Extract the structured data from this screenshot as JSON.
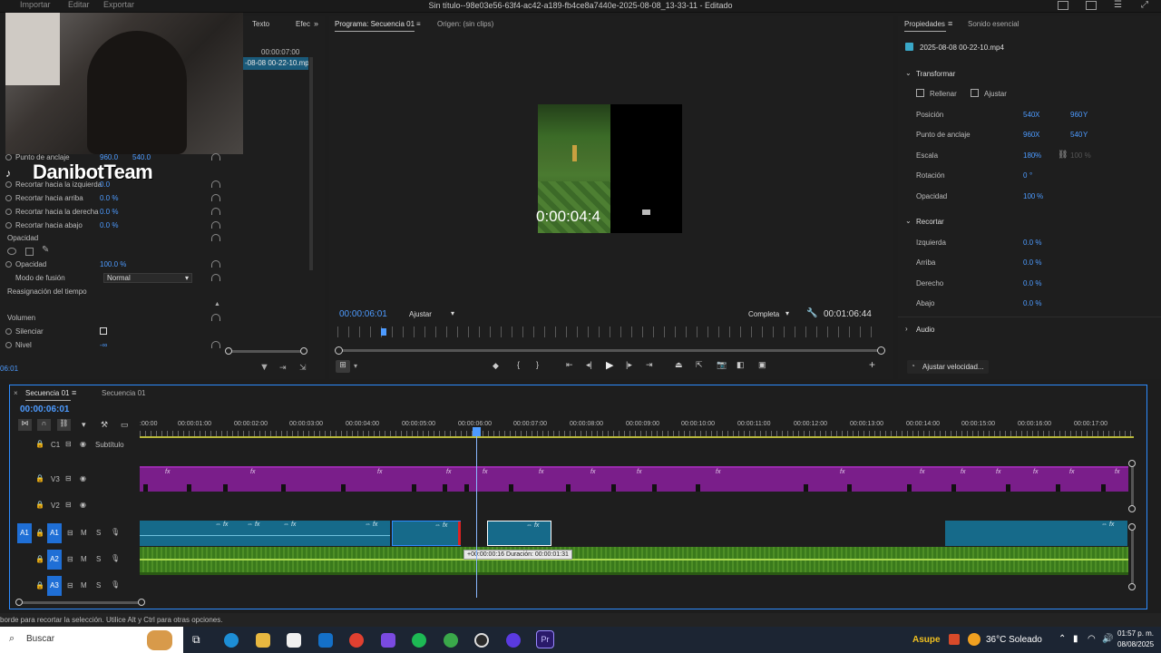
{
  "app": {
    "title": "Sin título--98e03e56-63f4-ac42-a189-fb4ce8a7440e-2025-08-08_13-33-11 - Editado",
    "menu": [
      "Importar",
      "Editar",
      "Exportar"
    ]
  },
  "overlay": {
    "watermark": "DanibotTeam"
  },
  "project_panel": {
    "tabs": [
      "Texto",
      "Efec"
    ],
    "timecode": "00:00:07:00",
    "clip": "-08-08 00-22-10.mp4"
  },
  "effect_controls": {
    "rows": [
      {
        "label": "Punto de anclaje",
        "val1": "960.0",
        "val2": "540.0"
      },
      {
        "label": "Recortar hacia la izquierda",
        "val1": "0.0"
      },
      {
        "label": "Recortar hacia arriba",
        "val1": "0.0 %"
      },
      {
        "label": "Recortar hacia la derecha",
        "val1": "0.0 %"
      },
      {
        "label": "Recortar hacia abajo",
        "val1": "0.0 %"
      },
      {
        "label": "Opacidad",
        "val1": ""
      },
      {
        "label": "Opacidad",
        "val1": "100.0 %"
      },
      {
        "label": "Modo de fusión",
        "val1": "Normal"
      },
      {
        "label": "Reasignación del tiempo",
        "val1": ""
      },
      {
        "label": "Volumen",
        "val1": ""
      },
      {
        "label": "Silenciar",
        "val1": ""
      },
      {
        "label": "Nivel",
        "val1": "-∞"
      }
    ],
    "timecode": "06:01"
  },
  "program": {
    "tab_program": "Programa: Secuencia 01",
    "tab_source": "Origen: (sin clips)",
    "overlay_timecode": "0:00:04:4",
    "timecode": "00:00:06:01",
    "fit": "Ajustar",
    "quality": "Completa",
    "duration": "00:01:06:44"
  },
  "properties": {
    "tab_props": "Propiedades",
    "tab_sound": "Sonido esencial",
    "file": "2025-08-08 00-22-10.mp4",
    "transform": "Transformar",
    "fill": "Rellenar",
    "fit": "Ajustar",
    "rows": [
      {
        "label": "Posición",
        "a": "540",
        "au": "X",
        "b": "960",
        "bu": "Y"
      },
      {
        "label": "Punto de anclaje",
        "a": "960",
        "au": "X",
        "b": "540",
        "bu": "Y"
      },
      {
        "label": "Escala",
        "a": "180",
        "au": "%",
        "b": "100 %",
        "bu": ""
      },
      {
        "label": "Rotación",
        "a": "0",
        "au": "°",
        "b": "",
        "bu": ""
      },
      {
        "label": "Opacidad",
        "a": "100",
        "au": "%",
        "b": "",
        "bu": ""
      }
    ],
    "crop": "Recortar",
    "crop_rows": [
      {
        "label": "Izquierda",
        "val": "0.0 %"
      },
      {
        "label": "Arriba",
        "val": "0.0 %"
      },
      {
        "label": "Derecho",
        "val": "0.0 %"
      },
      {
        "label": "Abajo",
        "val": "0.0 %"
      }
    ],
    "audio": "Audio",
    "speed": "Ajustar velocidad..."
  },
  "timeline": {
    "tab1": "Secuencia 01",
    "tab2": "Secuencia 01",
    "timecode": "00:00:06:01",
    "ruler": [
      ":00:00",
      "00:00:01:00",
      "00:00:02:00",
      "00:00:03:00",
      "00:00:04:00",
      "00:00:05:00",
      "00:00:06:00",
      "00:00:07:00",
      "00:00:08:00",
      "00:00:09:00",
      "00:00:10:00",
      "00:00:11:00",
      "00:00:12:00",
      "00:00:13:00",
      "00:00:14:00",
      "00:00:15:00",
      "00:00:16:00",
      "00:00:17:00"
    ],
    "tracks": [
      {
        "name": "C1",
        "label": "Subtítulo"
      },
      {
        "name": "V3",
        "label": ""
      },
      {
        "name": "V2",
        "label": ""
      },
      {
        "name": "A1",
        "label": ""
      },
      {
        "name": "A2",
        "label": ""
      },
      {
        "name": "A3",
        "label": ""
      }
    ],
    "tooltip": "+00:00:00:16 Duración: 00:00:01:31"
  },
  "status": {
    "hint": "borde para recortar la selección. Utilice Alt y Ctrl para otras opciones."
  },
  "taskbar": {
    "search": "Buscar",
    "weather_city": "Asupe",
    "weather": "36°C Soleado",
    "time": "01:57 p. m.",
    "date": "08/08/2025"
  },
  "colors": {
    "accent": "#2d8cff",
    "video_clip": "#7a1e8a",
    "av_clip": "#166a8a",
    "audio_clip": "#3c7a1e"
  }
}
